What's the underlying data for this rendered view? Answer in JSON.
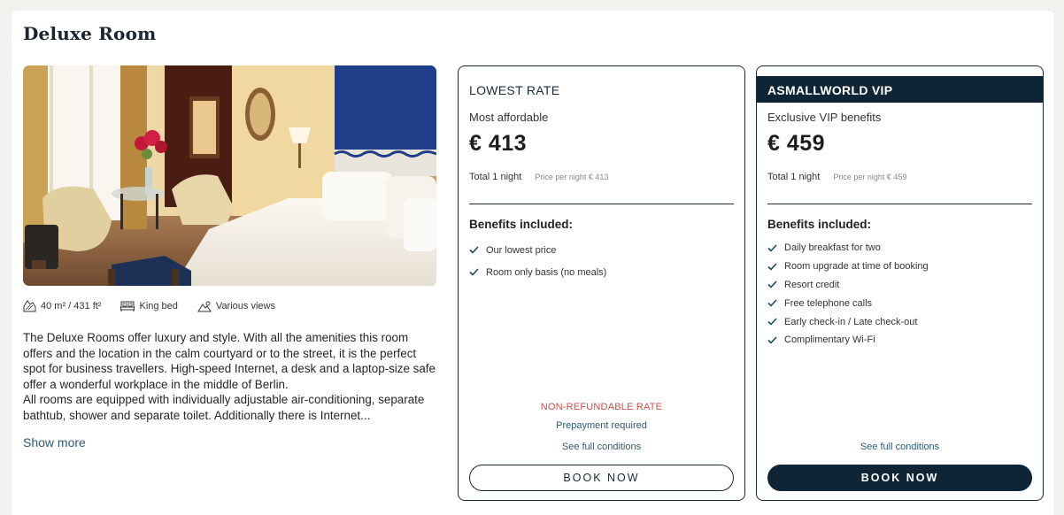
{
  "room": {
    "title": "Deluxe Room",
    "features": [
      {
        "icon": "area-icon",
        "label": "40 m² / 431 ft²"
      },
      {
        "icon": "bed-icon",
        "label": "King bed"
      },
      {
        "icon": "mountain-view-icon",
        "label": "Various views"
      }
    ],
    "description_line1": "The Deluxe Rooms offer luxury and style. With all the amenities this room offers and the location in the calm courtyard or to the street, it is the perfect spot for business travellers. High-speed Internet, a desk and a laptop-size safe offer a wonderful workplace in the middle of Berlin.",
    "description_line2": "All rooms are equipped with individually adjustable air-conditioning, separate bathtub, shower and separate toilet. Additionally there is Internet...",
    "show_more": "Show more"
  },
  "rates": {
    "lowest": {
      "name": "LOWEST RATE",
      "subtitle": "Most affordable",
      "price": "€ 413",
      "total": "Total 1 night",
      "per_night": "Price per night € 413",
      "benefits_title": "Benefits included:",
      "benefits": [
        "Our lowest price",
        "Room only basis (no meals)"
      ],
      "non_refundable": "NON-REFUNDABLE RATE",
      "prepayment": "Prepayment required",
      "conditions": "See full conditions",
      "book": "BOOK NOW"
    },
    "vip": {
      "name": "ASMALLWORLD VIP",
      "subtitle": "Exclusive VIP benefits",
      "price": "€ 459",
      "total": "Total 1 night",
      "per_night": "Price per night € 459",
      "benefits_title": "Benefits included:",
      "benefits": [
        "Daily breakfast for two",
        "Room upgrade at time of booking",
        "Resort credit",
        "Free telephone calls",
        "Early check-in / Late check-out",
        "Complimentary Wi-Fi"
      ],
      "conditions": "See full conditions",
      "book": "BOOK NOW"
    }
  },
  "colors": {
    "navy": "#0f2535",
    "accent_link": "#2e5a73",
    "non_refundable": "#c8504c"
  }
}
